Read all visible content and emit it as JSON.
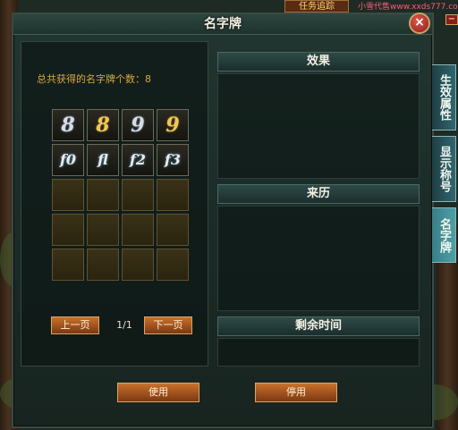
{
  "window": {
    "title": "名字牌",
    "close_glyph": "×"
  },
  "top": {
    "quest_tab": "任务追踪",
    "watermark": "小雪代售www.xxds777.com"
  },
  "left_panel": {
    "count_label": "总共获得的名字牌个数：8",
    "slots": [
      {
        "glyph": "8",
        "style": "silver"
      },
      {
        "glyph": "8",
        "style": "gold"
      },
      {
        "glyph": "9",
        "style": "silver"
      },
      {
        "glyph": "9",
        "style": "gold"
      },
      {
        "glyph": "f0",
        "style": "white"
      },
      {
        "glyph": "fl",
        "style": "white"
      },
      {
        "glyph": "f2",
        "style": "white"
      },
      {
        "glyph": "f3",
        "style": "white"
      },
      {},
      {},
      {},
      {},
      {},
      {},
      {},
      {},
      {},
      {},
      {},
      {}
    ],
    "prev_page": "上一页",
    "page_indicator": "1/1",
    "next_page": "下一页"
  },
  "right_panel": {
    "effect_header": "效果",
    "source_header": "来历",
    "time_header": "剩余时间"
  },
  "actions": {
    "use": "使用",
    "disable": "停用"
  },
  "side_tabs": [
    {
      "label": "生效属性"
    },
    {
      "label": "显示称号"
    },
    {
      "label": "名字牌"
    }
  ],
  "colors": {
    "accent_gold": "#d8a742",
    "button_orange": "#c8712c",
    "panel_teal": "#2e4a48"
  }
}
